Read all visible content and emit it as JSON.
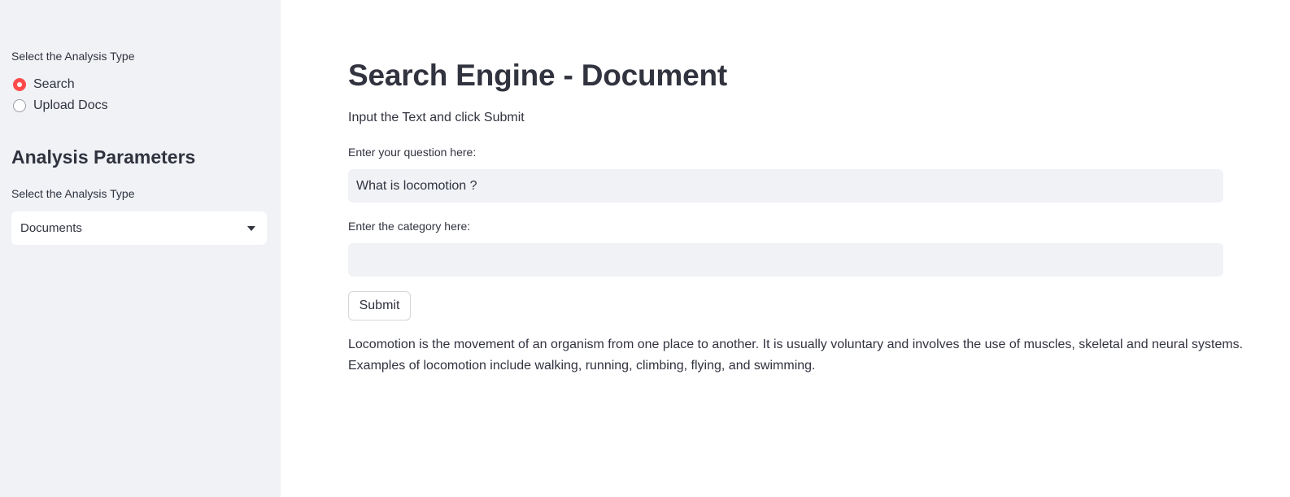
{
  "sidebar": {
    "analysis_type_label": "Select the Analysis Type",
    "radio_options": [
      {
        "label": "Search",
        "selected": true
      },
      {
        "label": "Upload Docs",
        "selected": false
      }
    ],
    "parameters_heading": "Analysis Parameters",
    "select_label": "Select the Analysis Type",
    "select_value": "Documents",
    "select_icon": "chevron-down-icon"
  },
  "main": {
    "title": "Search Engine - Document",
    "subtitle": "Input the Text and click Submit",
    "question_label": "Enter your question here:",
    "question_value": "What is locomotion ?",
    "category_label": "Enter the category here:",
    "category_value": "",
    "submit_label": "Submit",
    "answer_line1": "Locomotion is the movement of an organism from one place to another. It is usually voluntary and involves the use of muscles, skeletal and neural systems.",
    "answer_line2": "Examples of locomotion include walking, running, climbing, flying, and swimming."
  },
  "colors": {
    "accent": "#ff4b4b",
    "sidebar_bg": "#f0f2f6",
    "text": "#31333f"
  }
}
